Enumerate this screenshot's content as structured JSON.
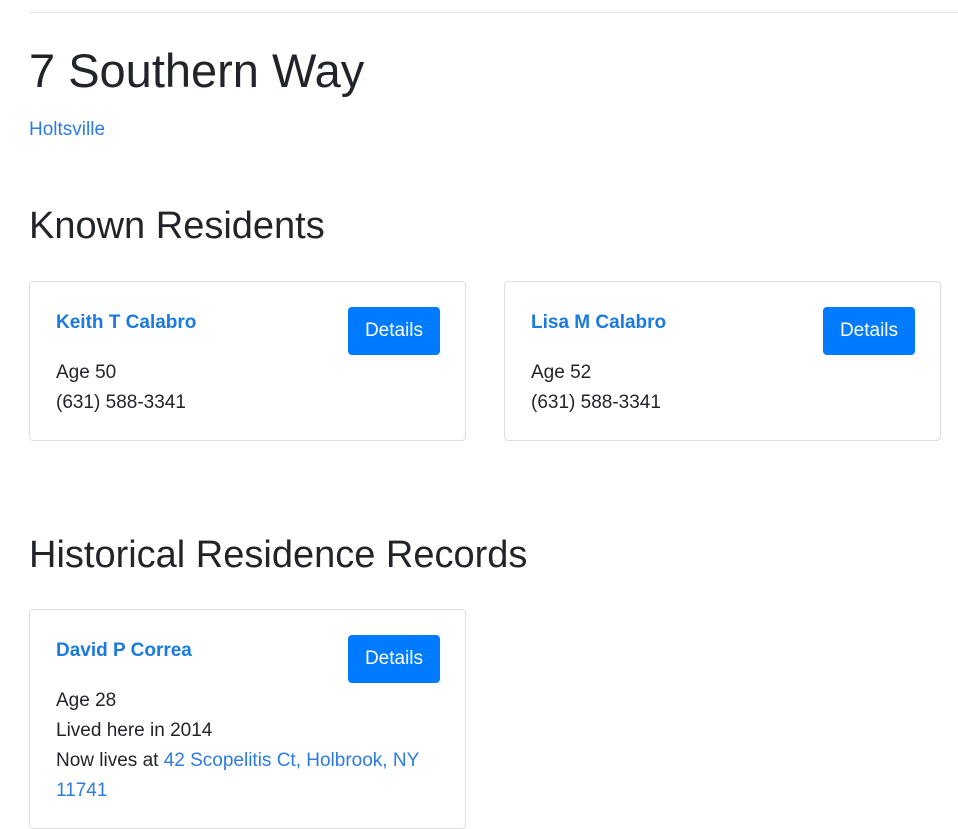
{
  "address": {
    "title": "7 Southern Way",
    "city_link": "Holtsville"
  },
  "known_residents": {
    "heading": "Known Residents",
    "people": [
      {
        "name": "Keith T Calabro",
        "details_label": "Details",
        "age": "Age 50",
        "phone": "(631) 588-3341"
      },
      {
        "name": "Lisa M Calabro",
        "details_label": "Details",
        "age": "Age 52",
        "phone": "(631) 588-3341"
      }
    ]
  },
  "historical_records": {
    "heading": "Historical Residence Records",
    "people": [
      {
        "name": "David P Correa",
        "details_label": "Details",
        "age": "Age 28",
        "lived_here": "Lived here in 2014",
        "now_lives_prefix": "Now lives at",
        "now_lives_address": "42 Scopelitis Ct, Holbrook, NY 11741"
      }
    ]
  },
  "colors": {
    "link": "#2c7be5",
    "button": "#007bff",
    "text": "#212529",
    "card_border": "#dfdfdf"
  }
}
